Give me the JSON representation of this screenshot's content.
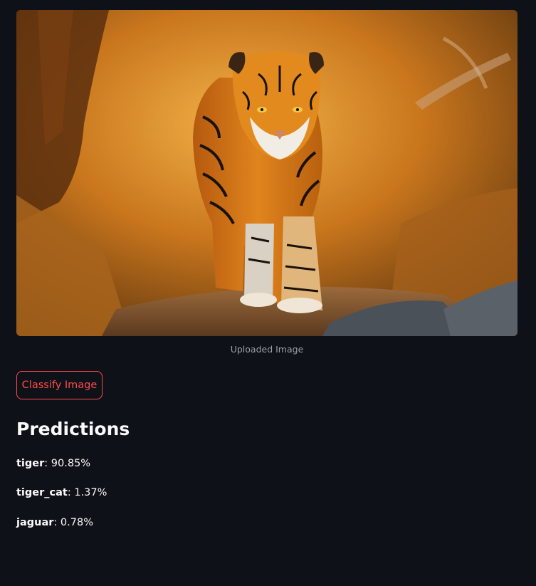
{
  "image": {
    "caption": "Uploaded Image",
    "subject": "tiger-photo"
  },
  "classify_button": {
    "label": "Classify Image"
  },
  "predictions": {
    "heading": "Predictions",
    "items": [
      {
        "label": "tiger",
        "value": "90.85%"
      },
      {
        "label": "tiger_cat",
        "value": "1.37%"
      },
      {
        "label": "jaguar",
        "value": "0.78%"
      }
    ]
  },
  "colors": {
    "background": "#0e1117",
    "accent": "#ff4b4b",
    "caption": "#9b9ea6",
    "text": "#fafafa"
  }
}
